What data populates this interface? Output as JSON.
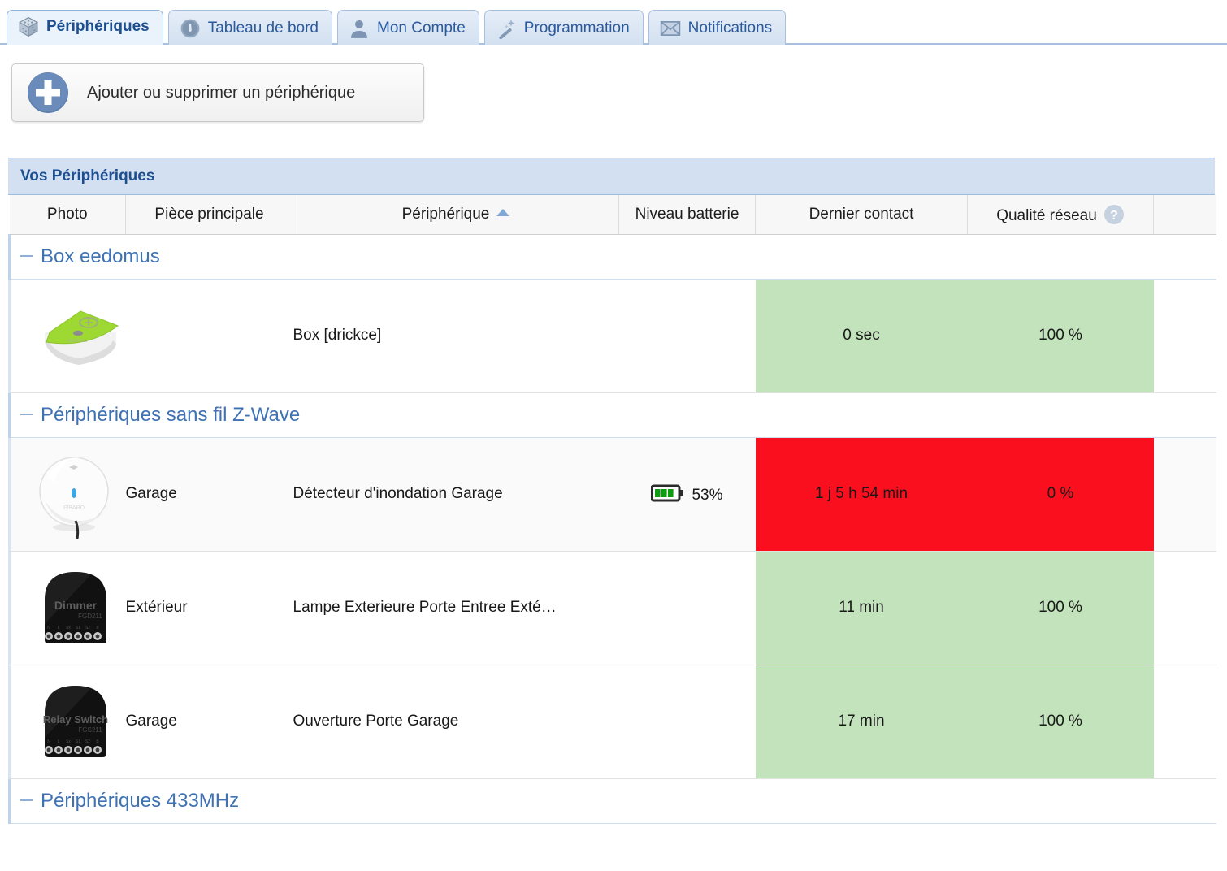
{
  "tabs": [
    {
      "label": "Périphériques",
      "icon": "cube-icon",
      "active": true
    },
    {
      "label": "Tableau de bord",
      "icon": "gauge-icon",
      "active": false
    },
    {
      "label": "Mon Compte",
      "icon": "user-icon",
      "active": false
    },
    {
      "label": "Programmation",
      "icon": "magic-wand-icon",
      "active": false
    },
    {
      "label": "Notifications",
      "icon": "envelope-icon",
      "active": false
    }
  ],
  "toolbar": {
    "add_device_label": "Ajouter ou supprimer un périphérique",
    "add_icon": "plus-circle-icon"
  },
  "panel": {
    "title": "Vos Périphériques",
    "columns": {
      "photo": "Photo",
      "room": "Pièce principale",
      "device": "Périphérique",
      "battery": "Niveau batterie",
      "last_contact": "Dernier contact",
      "network_quality": "Qualité réseau",
      "sort_indicator": "ascending",
      "help_icon": "question-mark-icon"
    },
    "groups": [
      {
        "label": "Box eedomus",
        "collapse_icon": "minus-icon",
        "rows": [
          {
            "photo": "eedomus-box-thumbnail",
            "room": "",
            "device": "Box [drickce]",
            "battery": "",
            "battery_percent": null,
            "last_contact": "0 sec",
            "quality": "100 %",
            "status": "ok"
          }
        ]
      },
      {
        "label": "Périphériques sans fil Z-Wave",
        "collapse_icon": "minus-icon",
        "rows": [
          {
            "photo": "flood-sensor-thumbnail",
            "room": "Garage",
            "device": "Détecteur d'inondation Garage",
            "battery": "53%",
            "battery_percent": 53,
            "last_contact": "1 j 5 h 54 min",
            "quality": "0 %",
            "status": "bad"
          },
          {
            "photo": "fibaro-dimmer-thumbnail",
            "room": "Extérieur",
            "device": "Lampe Exterieure Porte Entree Exté…",
            "battery": "",
            "battery_percent": null,
            "last_contact": "11 min",
            "quality": "100 %",
            "status": "ok"
          },
          {
            "photo": "fibaro-relay-switch-thumbnail",
            "room": "Garage",
            "device": "Ouverture Porte Garage",
            "battery": "",
            "battery_percent": null,
            "last_contact": "17 min",
            "quality": "100 %",
            "status": "ok"
          }
        ]
      },
      {
        "label": "Périphériques 433MHz",
        "collapse_icon": "minus-icon",
        "rows": []
      }
    ]
  },
  "colors": {
    "status_ok": "#c3e3bc",
    "status_bad": "#fa0f1e",
    "accent_blue": "#2a5a9e",
    "panel_header": "#d3e0f2",
    "group_label": "#3f72b3"
  }
}
